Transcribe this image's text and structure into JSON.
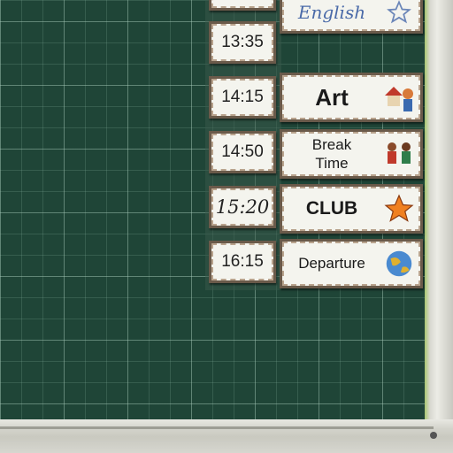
{
  "times": [
    "13:35",
    "14:15",
    "14:50",
    "15:20",
    "16:15"
  ],
  "subjects": {
    "english": "English",
    "art": "Art",
    "break_line1": "Break",
    "break_line2": "Time",
    "club": "CLUB",
    "departure": "Departure"
  },
  "colors": {
    "board": "#1f4537",
    "star": "#f08020",
    "card": "#f4f4ee"
  },
  "icons": [
    "star-icon",
    "house-icon",
    "children-icon",
    "star-icon",
    "globe-icon"
  ]
}
